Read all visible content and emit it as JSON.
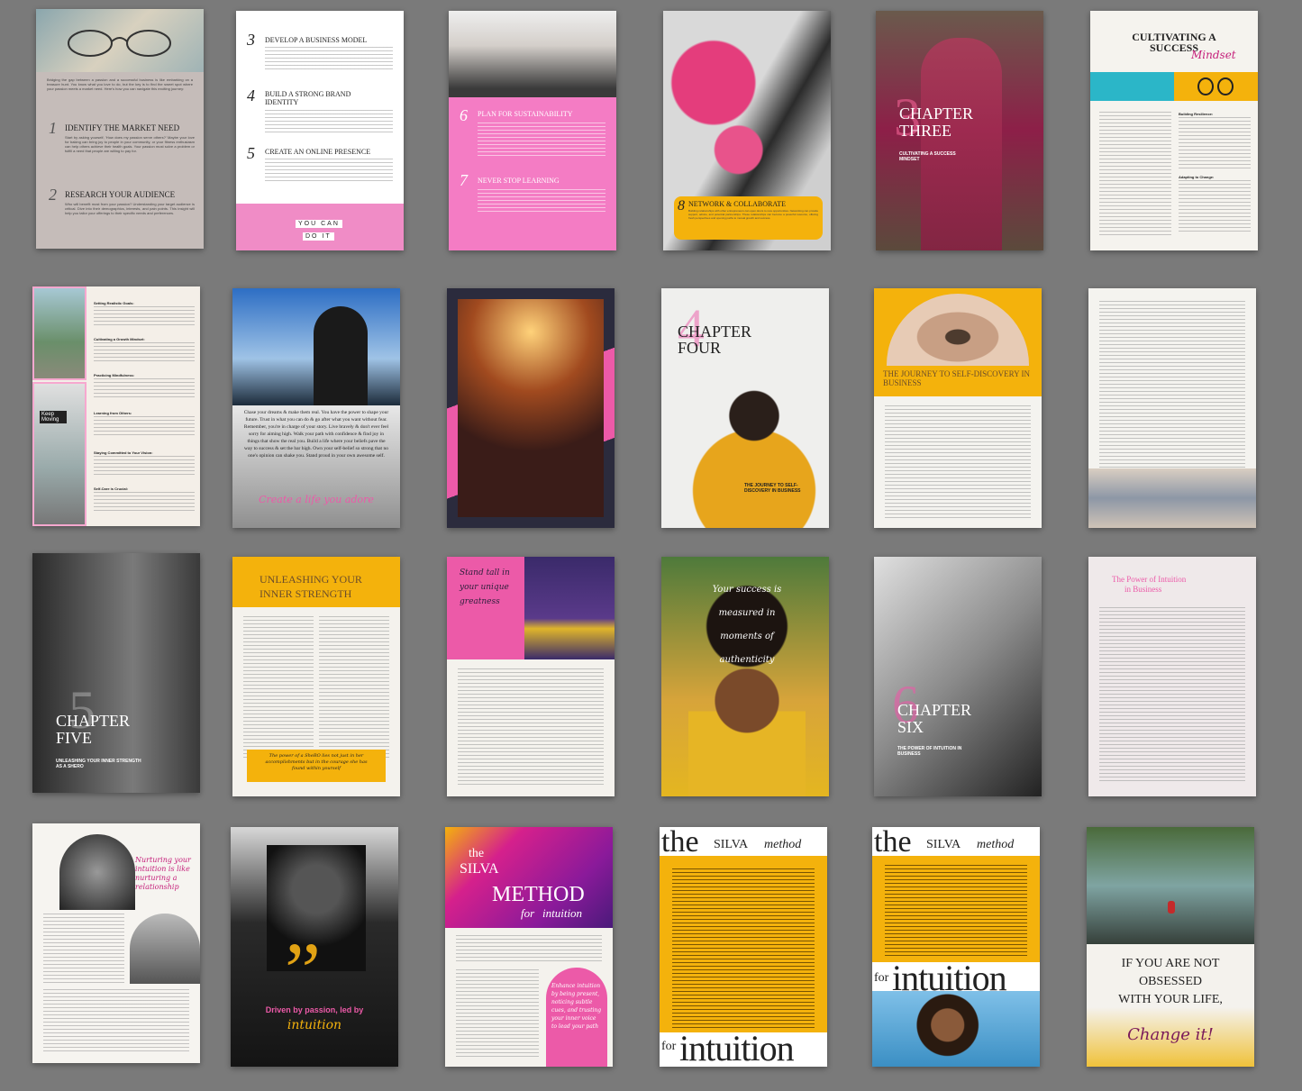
{
  "p1": {
    "intro": "Bridging the gap between a passion and a successful business is like embarking on a treasure hunt. You know what you love to do, but the key is to find the sweet spot where your passion meets a market need. Here's how you can navigate this exciting journey:",
    "s1_num": "1",
    "s1_title": "IDENTIFY THE MARKET NEED",
    "s1_body": "Start by asking yourself, 'How does my passion serve others?' Maybe your love for baking can bring joy to people in your community, or your fitness enthusiasm can help others achieve their health goals. Your passion must solve a problem or fulfill a need that people are willing to pay for.",
    "s2_num": "2",
    "s2_title": "RESEARCH YOUR AUDIENCE",
    "s2_body": "Who will benefit most from your passion? Understanding your target audience is critical. Dive into their demographics, interests, and pain points. This insight will help you tailor your offerings to their specific needs and preferences."
  },
  "p2": {
    "s3_num": "3",
    "s3_title": "DEVELOP A BUSINESS MODEL",
    "s4_num": "4",
    "s4_title": "BUILD A STRONG BRAND IDENTITY",
    "s5_num": "5",
    "s5_title": "CREATE AN ONLINE PRESENCE",
    "tile1": "YOU CAN",
    "tile2": "DO IT"
  },
  "p3": {
    "s6_num": "6",
    "s6_title": "PLAN FOR SUSTAINABILITY",
    "s7_num": "7",
    "s7_title": "NEVER STOP LEARNING"
  },
  "p4": {
    "s8_num": "8",
    "s8_title": "NETWORK & COLLABORATE",
    "s8_body": "Building relationships with other entrepreneurs can open doors to new opportunities. Networking can provide support, advice, and potential partnerships. These relationships can become a powerful resource, offering fresh perspectives and opening paths to mutual growth and success."
  },
  "p5": {
    "num": "3",
    "title1": "CHAPTER",
    "title2": "THREE",
    "sub": "CULTIVATING A SUCCESS MINDSET"
  },
  "p6": {
    "title1": "CULTIVATING A",
    "title2": "SUCCESS",
    "script": "Mindset",
    "h1": "Building Resilience:",
    "h2": "Embracing Positivity:",
    "h3": "Adapting to Change:"
  },
  "p7": {
    "sign": "Keep Moving",
    "h1": "Setting Realistic Goals:",
    "h2": "Cultivating a Growth Mindset:",
    "h3": "Practicing Mindfulness:",
    "h4": "Learning from Others:",
    "h5": "Staying Committed to Your Vision:",
    "h6": "Self-Care is Crucial:"
  },
  "p8": {
    "body": "Chase your dreams & make them real. You have the power to shape your future. Trust in what you can do & go after what you want without fear. Remember, you're in charge of your story. Live bravely & don't ever feel sorry for aiming high. Walk your path with confidence & find joy in things that show the real you. Build a life where your beliefs pave the way to success & set the bar high. Own your self-belief so strong that no one's opinion can shake you. Stand proud in your own awesome self.",
    "script": "Create a life you adore"
  },
  "p10": {
    "num": "4",
    "title1": "CHAPTER",
    "title2": "FOUR",
    "sub": "THE JOURNEY TO SELF-DISCOVERY IN BUSINESS"
  },
  "p11": {
    "title": "THE JOURNEY TO SELF-DISCOVERY IN BUSINESS"
  },
  "p13": {
    "num": "5",
    "title1": "CHAPTER",
    "title2": "FIVE",
    "sub": "UNLEASHING YOUR INNER STRENGTH AS A SHERO"
  },
  "p14": {
    "title1": "UNLEASHING YOUR",
    "title2": "INNER STRENGTH",
    "quote": "The power of a SheRO lies not just in her accomplishments but in the courage she has found within yourself"
  },
  "p15": {
    "script": "Stand tall in your unique greatness"
  },
  "p16": {
    "script": "Your success is measured in moments of authenticity"
  },
  "p17": {
    "num": "6",
    "title1": "CHAPTER",
    "title2": "SIX",
    "sub": "THE POWER OF INTUITION IN BUSINESS"
  },
  "p18": {
    "title1": "The Power of Intuition",
    "title2": "in Business"
  },
  "p19": {
    "script": "Nurturing your intuition is like nurturing a relationship"
  },
  "p20": {
    "quote_mark": "”",
    "line1": "Driven by passion, led by",
    "script": "intuition"
  },
  "p21": {
    "the": "the",
    "silva": "SILVA",
    "method": "METHOD",
    "for": "for",
    "intuition": "intuition",
    "script": "Enhance intuition by being present, noticing subtle cues, and trusting your inner voice to lead your path"
  },
  "p22": {
    "the": "the",
    "silva": "SILVA",
    "method": "method",
    "for": "for",
    "intuition": "intuition"
  },
  "p23": {
    "the": "the",
    "silva": "SILVA",
    "method": "method",
    "for": "for",
    "intuition": "intuition"
  },
  "p24": {
    "line1": "IF YOU ARE NOT",
    "line2": "OBSESSED",
    "line3": "WITH YOUR LIFE,",
    "script": "Change it!"
  },
  "colors": {
    "pink": "#ec5aa8",
    "yellow": "#f4b20c",
    "magenta": "#c51f7a",
    "cream": "#f3f1ec",
    "background": "#7a7a7a"
  }
}
